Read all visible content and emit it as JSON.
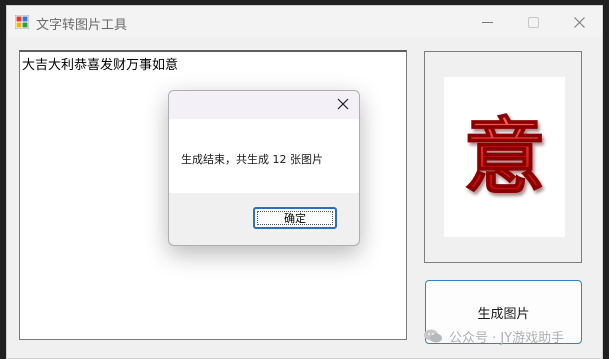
{
  "window": {
    "title": "文字转图片工具",
    "controls": {
      "minimize": "—",
      "maximize": "☐",
      "close": "✕"
    }
  },
  "textarea": {
    "value": "大吉大利恭喜发财万事如意"
  },
  "preview": {
    "character": "意",
    "character_color": "#e02020"
  },
  "generate_button": {
    "label": "生成图片"
  },
  "dialog": {
    "message": "生成结束，共生成 12 张图片",
    "ok_label": "确定"
  },
  "watermark": {
    "text": "公众号 · JY游戏助手"
  },
  "colors": {
    "accent": "#3c7fc5",
    "window_bg": "#f0f0f0",
    "dialog_title_bg": "#f4f0f8"
  }
}
